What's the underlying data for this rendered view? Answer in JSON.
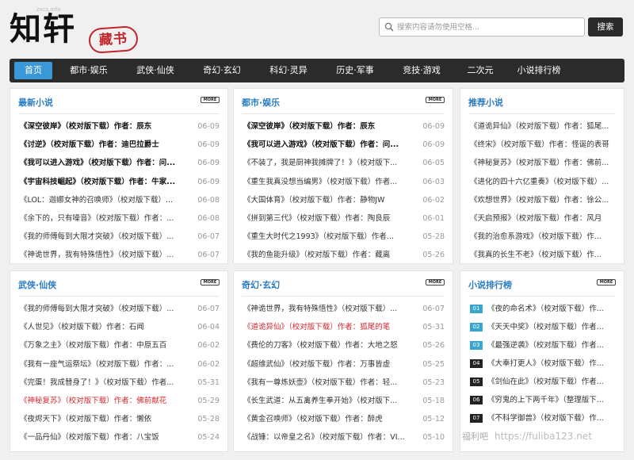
{
  "logo": {
    "text": "知轩",
    "seal": "藏书",
    "url": "zxcs.info"
  },
  "search": {
    "placeholder": "搜索内容请勿使用空格...",
    "button": "搜索"
  },
  "nav": [
    "首页",
    "都市·娱乐",
    "武侠·仙侠",
    "奇幻·玄幻",
    "科幻·灵异",
    "历史·军事",
    "竞技·游戏",
    "二次元",
    "小说排行榜"
  ],
  "more_label": "MORE",
  "panels": {
    "latest": {
      "title": "最新小说",
      "rows": [
        {
          "text": "《深空彼岸》（校对版下载）作者：辰东",
          "date": "06-09"
        },
        {
          "text": "《讨逆》（校对版下载）作者：迪巴拉爵士",
          "date": "06-09"
        },
        {
          "text": "《我可以进入游戏》（校对版下载）作者：问...",
          "date": "06-09"
        },
        {
          "text": "《宇宙科技崛起》（校对版下载）作者：牛家...",
          "date": "06-09"
        },
        {
          "text": "《LOL：迦娜女神的召唤师》（校对版下载）...",
          "date": "06-08"
        },
        {
          "text": "《余下的，只有噪音》（校对版下载）作者：...",
          "date": "06-08"
        },
        {
          "text": "《我的师傅每到大限才突破》（校对版下载）...",
          "date": "06-07"
        },
        {
          "text": "《神诡世界，我有特殊悟性》（校对版下载）...",
          "date": "06-07"
        }
      ]
    },
    "urban": {
      "title": "都市·娱乐",
      "rows": [
        {
          "text": "《深空彼岸》（校对版下载）作者：辰东",
          "date": "06-09"
        },
        {
          "text": "《我可以进入游戏》（校对版下载）作者：问...",
          "date": "06-09"
        },
        {
          "text": "《不装了，我是厨神我摊牌了！》（校对版下...",
          "date": "06-05"
        },
        {
          "text": "《重生我真没想当编男》（校对版下载）作者...",
          "date": "06-03"
        },
        {
          "text": "《大国体育》（校对版下载）作者：静物JW",
          "date": "06-02"
        },
        {
          "text": "《拼到第三代》（校对版下载）作者：陶良辰",
          "date": "06-01"
        },
        {
          "text": "《重生大时代之1993》（校对版下载）作者...",
          "date": "05-28"
        },
        {
          "text": "《我的鱼能升级》（校对版下载）作者：藏离",
          "date": "05-26"
        }
      ]
    },
    "recommend": {
      "title": "推荐小说",
      "rows": [
        {
          "text": "《道诡异仙》（校对版下载）作者：狐尾..."
        },
        {
          "text": "《终宋》（校对版下载）作者：怪诞的表哥"
        },
        {
          "text": "《神秘复苏》（校对版下载）作者：佛前..."
        },
        {
          "text": "《进化的四十六亿重奏》（校对版下载）..."
        },
        {
          "text": "《欢想世界》（校对版下载）作者：徐公..."
        },
        {
          "text": "《天启预报》（校对版下载）作者：风月"
        },
        {
          "text": "《我的治愈系游戏》（校对版下载）作..."
        },
        {
          "text": "《我真的长生不老》（校对版下载）作..."
        }
      ]
    },
    "wuxia": {
      "title": "武侠·仙侠",
      "rows": [
        {
          "text": "《我的师傅每到大限才突破》（校对版下载）...",
          "date": "06-07"
        },
        {
          "text": "《人世见》（校对版下载）作者：石闻",
          "date": "06-04"
        },
        {
          "text": "《万象之主》（校对版下载）作者：中原五百",
          "date": "06-02"
        },
        {
          "text": "《我有一座气运祭坛》（校对版下载）作者：...",
          "date": "06-02"
        },
        {
          "text": "《完蛋！我成替身了！》（校对版下载）作者...",
          "date": "05-31"
        },
        {
          "text": "《神秘复苏》（校对版下载）作者：佛前献花",
          "date": "05-29",
          "red": true
        },
        {
          "text": "《夜烬天下》（校对版下载）作者：懒依",
          "date": "05-28"
        },
        {
          "text": "《一品丹仙》（校对版下载）作者：八宝饭",
          "date": "05-24"
        }
      ]
    },
    "fantasy": {
      "title": "奇幻·玄幻",
      "rows": [
        {
          "text": "《神诡世界，我有特殊悟性》（校对版下载）...",
          "date": "06-07"
        },
        {
          "text": "《道诡异仙》（校对版下载）作者：狐尾的笔",
          "date": "05-31",
          "red": true
        },
        {
          "text": "《费伦的刀客》（校对版下载）作者：大地之怒",
          "date": "05-26"
        },
        {
          "text": "《超维武仙》（校对版下载）作者：万事皆虚",
          "date": "05-25"
        },
        {
          "text": "《我有一尊炼妖壶》（校对版下载）作者：轻...",
          "date": "05-23"
        },
        {
          "text": "《长生武道：从五禽养生拳开始》（校对版下...",
          "date": "05-18"
        },
        {
          "text": "《黄金召唤师》（校对版下载）作者：醉虎",
          "date": "05-12"
        },
        {
          "text": "《战锤：以帝皇之名》（校对版下载）作者：VI...",
          "date": "05-10"
        }
      ]
    },
    "ranking": {
      "title": "小说排行榜",
      "rows": [
        {
          "num": "01",
          "text": "《夜的命名术》（校对版下载）作..."
        },
        {
          "num": "02",
          "text": "《天天中奖》（校对版下载）作者..."
        },
        {
          "num": "03",
          "text": "《最强逆袭》（校对版下载）作者..."
        },
        {
          "num": "04",
          "text": "《大奉打更人》（校对版下载）作..."
        },
        {
          "num": "05",
          "text": "《剑仙在此》（校对版下载）作者..."
        },
        {
          "num": "06",
          "text": "《穷鬼的上下两千年》（整理版下..."
        },
        {
          "num": "07",
          "text": "《不科学御兽》（校对版下载）作..."
        }
      ]
    }
  },
  "watermark": {
    "cn": "福利吧",
    "url": "https://fuliba123.net"
  },
  "colors": {
    "accent": "#2a7cc2",
    "nav_bg": "#2b2b2b",
    "nav_active": "#3a98d6",
    "red": "#d4282f",
    "rank_hot": "#39a6cf",
    "rank_cold": "#222222"
  }
}
